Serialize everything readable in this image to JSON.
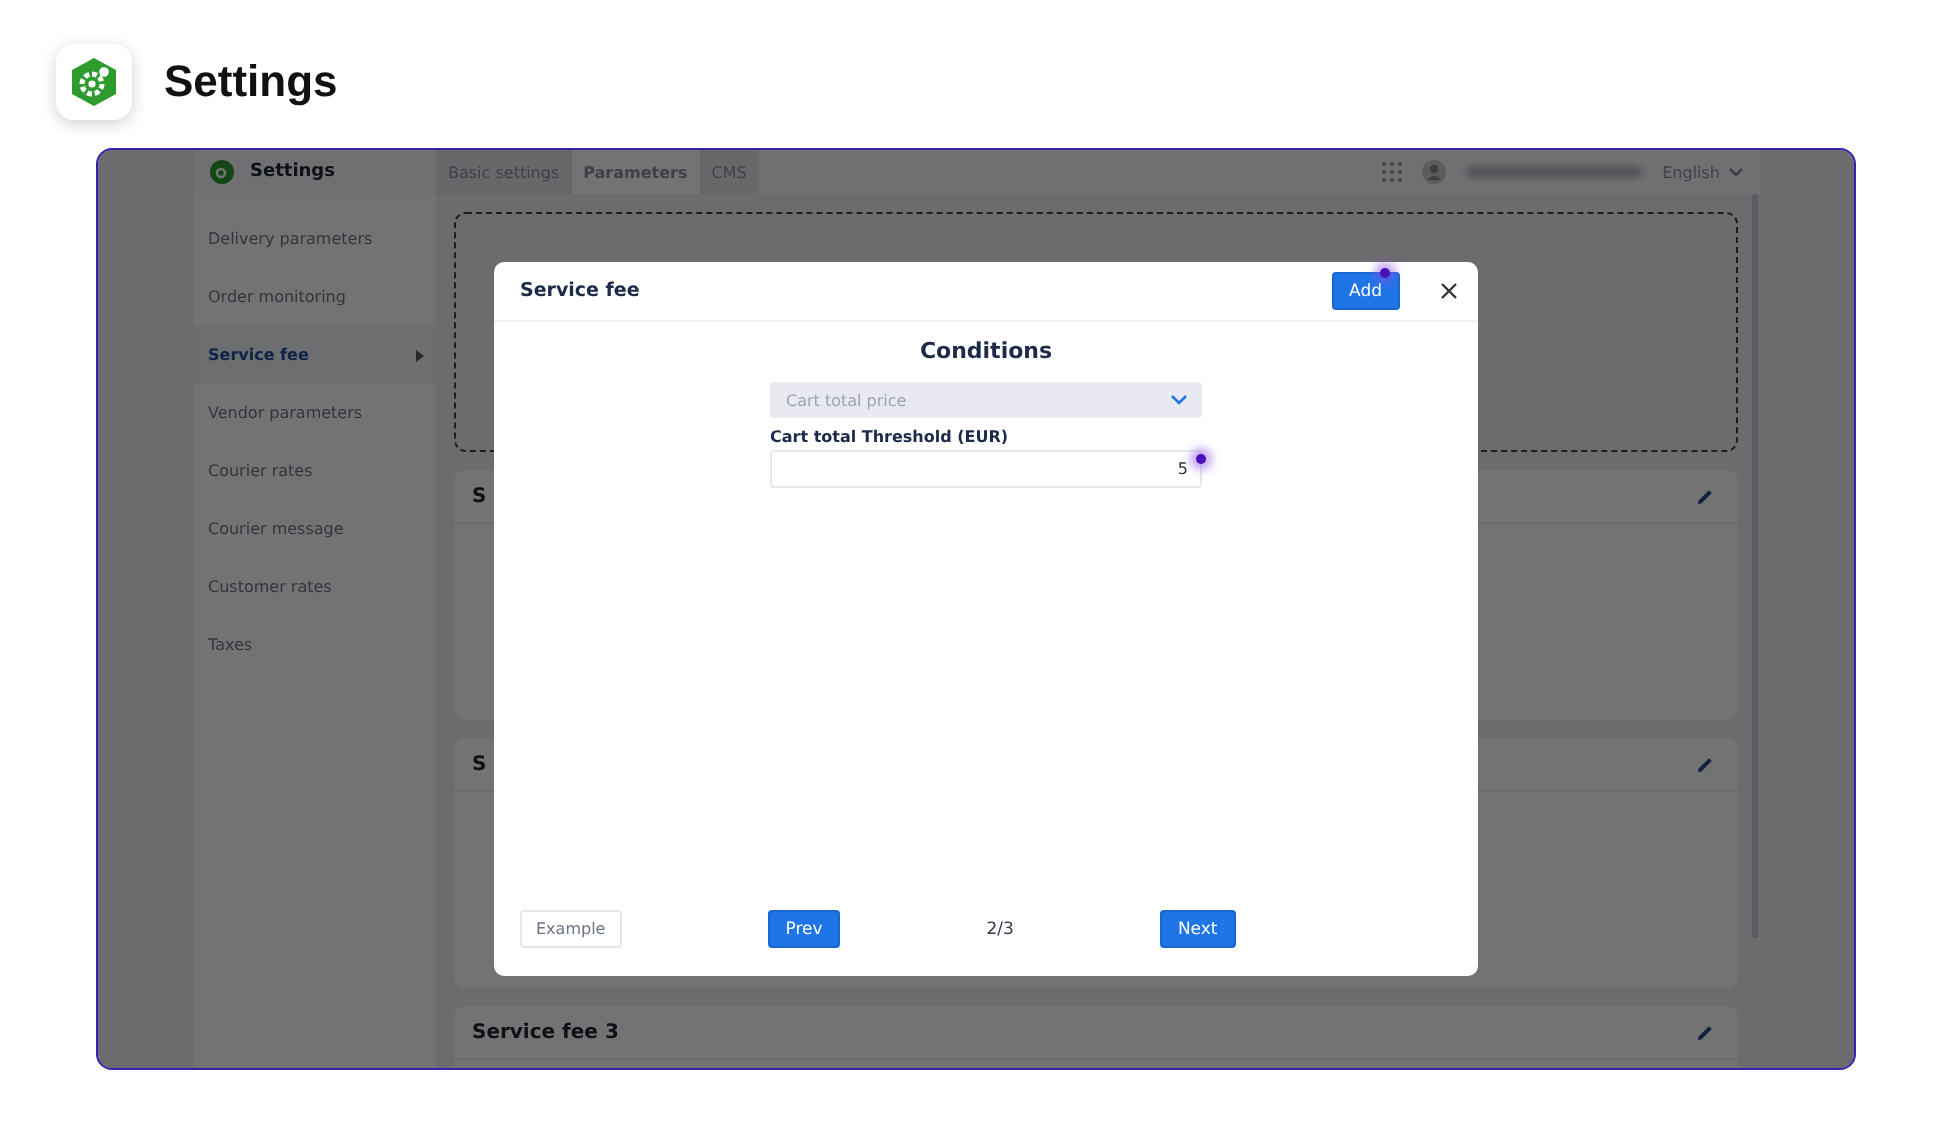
{
  "header": {
    "title": "Settings"
  },
  "app": {
    "brand": "Settings",
    "tabs": [
      {
        "label": "Basic settings",
        "selected": false
      },
      {
        "label": "Parameters",
        "selected": true
      },
      {
        "label": "CMS",
        "selected": false
      }
    ],
    "language": "English",
    "sidebar": {
      "items": [
        {
          "label": "Delivery parameters",
          "selected": false
        },
        {
          "label": "Order monitoring",
          "selected": false
        },
        {
          "label": "Service fee",
          "selected": true
        },
        {
          "label": "Vendor parameters",
          "selected": false
        },
        {
          "label": "Courier rates",
          "selected": false
        },
        {
          "label": "Courier message",
          "selected": false
        },
        {
          "label": "Customer rates",
          "selected": false
        },
        {
          "label": "Taxes",
          "selected": false
        }
      ]
    },
    "cards": [
      {
        "title": "S"
      },
      {
        "title": "S"
      },
      {
        "title": "Service fee 3"
      }
    ]
  },
  "modal": {
    "title": "Service fee",
    "add_button": "Add",
    "heading": "Conditions",
    "select": {
      "value": "Cart total price"
    },
    "field": {
      "label": "Cart total Threshold (EUR)",
      "value": "5"
    },
    "example_button": "Example",
    "prev_button": "Prev",
    "page": "2/3",
    "next_button": "Next"
  }
}
